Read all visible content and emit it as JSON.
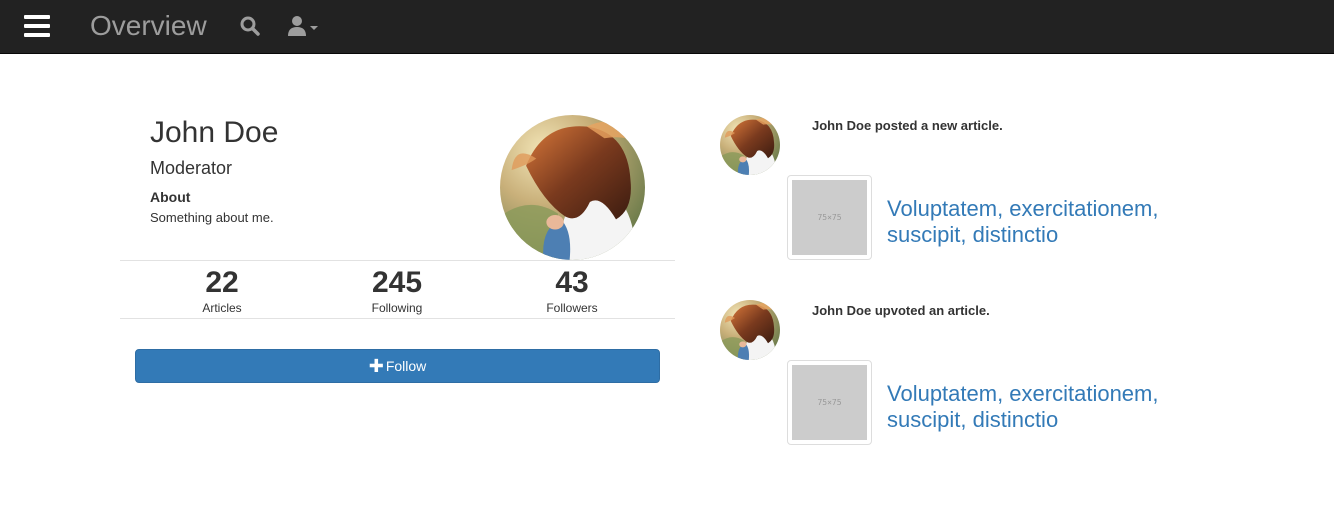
{
  "navbar": {
    "title": "Overview",
    "icons": [
      "menu-icon",
      "search-icon",
      "user-icon",
      "caret-down-icon"
    ]
  },
  "profile": {
    "name": "John Doe",
    "role": "Moderator",
    "about_heading": "About",
    "about_text": "Something about me.",
    "stats": [
      {
        "value": "22",
        "label": "Articles"
      },
      {
        "value": "245",
        "label": "Following"
      },
      {
        "value": "43",
        "label": "Followers"
      }
    ],
    "follow_label": "Follow"
  },
  "feed": [
    {
      "text": "John Doe posted a new article.",
      "thumb_label": "75×75",
      "article_title": "Voluptatem, exercitationem, suscipit, distinctio"
    },
    {
      "text": "John Doe upvoted an article.",
      "thumb_label": "75×75",
      "article_title": "Voluptatem, exercitationem, suscipit, distinctio"
    }
  ],
  "colors": {
    "navbar_bg": "#222222",
    "primary": "#337ab7",
    "placeholder": "#cccccc"
  }
}
